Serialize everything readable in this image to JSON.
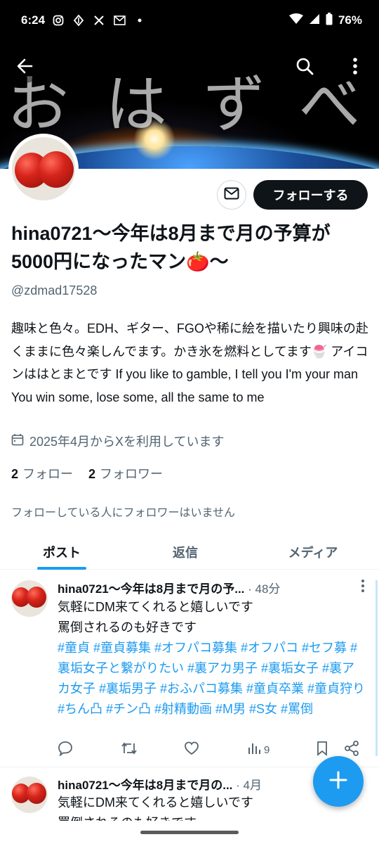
{
  "status_bar": {
    "time": "6:24",
    "notification_icons": [
      "instagram-icon",
      "app-icon",
      "x-icon",
      "mail-icon",
      "dot-icon"
    ],
    "battery": "76%"
  },
  "banner": {
    "text": "おはずべ"
  },
  "profile": {
    "follow_label": "フォローする",
    "display_name": "hina0721〜今年は8月まで月の予算が5000円になったマン🍅〜",
    "handle": "@zdmad17528",
    "bio": "趣味と色々。EDH、ギター、FGOや稀に絵を描いたり興味の赴くままに色々楽しんでます。かき氷を燃料としてます🍧 アイコンははとまとです If you like to gamble, I tell you I'm your man You win some, lose some, all the same to me",
    "joined": "2025年4月からXを利用しています",
    "following_count": "2",
    "following_label": "フォロー",
    "followers_count": "2",
    "followers_label": "フォロワー",
    "no_followers_note": "フォローしている人にフォロワーはいません"
  },
  "tabs": [
    {
      "label": "ポスト",
      "active": true
    },
    {
      "label": "返信",
      "active": false
    },
    {
      "label": "メディア",
      "active": false
    }
  ],
  "posts": [
    {
      "name": "hina0721〜今年は8月まで月の予...",
      "time": "· 48分",
      "text_lines": [
        "気軽にDM来てくれると嬉しいです",
        "罵倒されるのも好きです"
      ],
      "hashtags": "#童貞 #童貞募集 #オフパコ募集 #オフパコ #セフ募 #裏垢女子と繋がりたい #裏アカ男子 #裏垢女子 #裏アカ女子 #裏垢男子 #おふパコ募集 #童貞卒業 #童貞狩り #ちん凸 #チン凸 #射精動画 #M男 #S女 #罵倒",
      "views": "9"
    },
    {
      "name": "hina0721〜今年は8月まで月の...",
      "time": "· 4月",
      "text_lines": [
        "気軽にDM来てくれると嬉しいです",
        "罵倒されるのも好きです"
      ]
    }
  ],
  "colors": {
    "accent": "#1d9bf0",
    "text": "#0f1419",
    "secondary": "#536471"
  }
}
